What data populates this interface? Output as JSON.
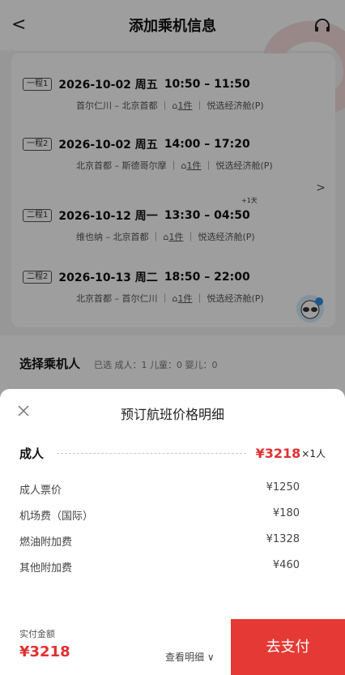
{
  "header": {
    "title": "添加乘机信息",
    "back_icon": "chevron-left-icon",
    "service_icon": "headset-icon"
  },
  "segments": [
    {
      "tag": "一程1",
      "date": "2026-10-02 周五",
      "time": "10:50 – 11:50",
      "route": "首尔仁川 – 北京首都",
      "bag": "1件",
      "cabin": "悦选经济舱(P)"
    },
    {
      "tag": "一程2",
      "date": "2026-10-02 周五",
      "time": "14:00 – 17:20",
      "route": "北京首都 – 斯德哥尔摩",
      "bag": "1件",
      "cabin": "悦选经济舱(P)"
    },
    {
      "tag": "二程1",
      "date": "2026-10-12 周一",
      "time": "13:30 – 04:50",
      "plus_day": "+1天",
      "route": "维也纳 – 北京首都",
      "bag": "1件",
      "cabin": "悦选经济舱(P)"
    },
    {
      "tag": "二程2",
      "date": "2026-10-13 周二",
      "time": "18:50 – 22:00",
      "route": "北京首都 – 首尔仁川",
      "bag": "1件",
      "cabin": "悦选经济舱(P)"
    }
  ],
  "passengers": {
    "title": "选择乘机人",
    "info": "已选 成人：1  儿童：0  婴儿：0"
  },
  "sheet": {
    "title": "预订航班价格明细",
    "adult": {
      "label": "成人",
      "price": "¥3218",
      "mult": "×1人"
    },
    "fees": [
      {
        "label": "成人票价",
        "value": "¥1250"
      },
      {
        "label": "机场费（国际）",
        "value": "¥180"
      },
      {
        "label": "燃油附加费",
        "value": "¥1328"
      },
      {
        "label": "其他附加费",
        "value": "¥460"
      }
    ],
    "pay_label": "实付金额",
    "pay_amount": "¥3218",
    "detail_link": "查看明细 ∨",
    "pay_button": "去支付"
  },
  "colors": {
    "accent": "#e53935",
    "price": "#e03030"
  }
}
